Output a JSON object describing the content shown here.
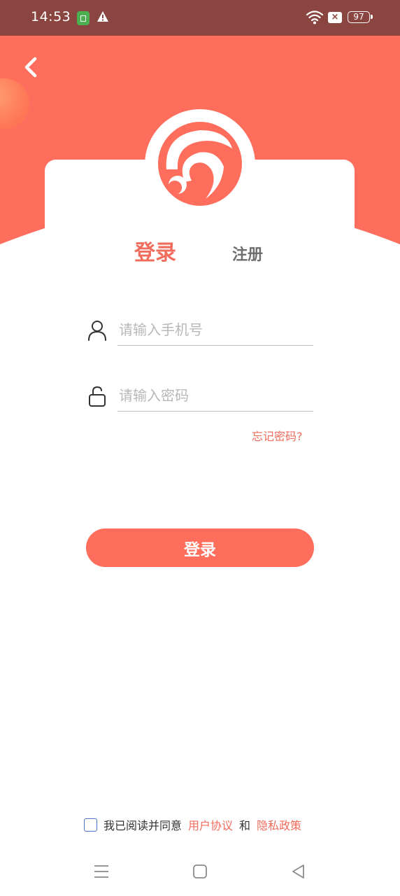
{
  "status_bar": {
    "time": "14:53",
    "battery": "97"
  },
  "tabs": {
    "login": "登录",
    "register": "注册"
  },
  "form": {
    "phone_placeholder": "请输入手机号",
    "password_placeholder": "请输入密码",
    "forgot_password": "忘记密码?",
    "login_button": "登录"
  },
  "agreement": {
    "text": "我已阅读并同意",
    "user_agreement": "用户协议",
    "and": "和",
    "privacy_policy": "隐私政策"
  },
  "colors": {
    "accent": "#ff6d5d",
    "status_bar": "#8b4540",
    "tab_active": "#f06c5c",
    "tab_inactive": "#6e6e6e",
    "checkbox_border": "#4a74c4"
  },
  "icons": {
    "back": "chevron-left-icon",
    "phone_field": "user-icon",
    "password_field": "unlock-icon",
    "nav_menu": "menu-icon",
    "nav_home": "square-icon",
    "nav_back": "triangle-left-icon"
  }
}
